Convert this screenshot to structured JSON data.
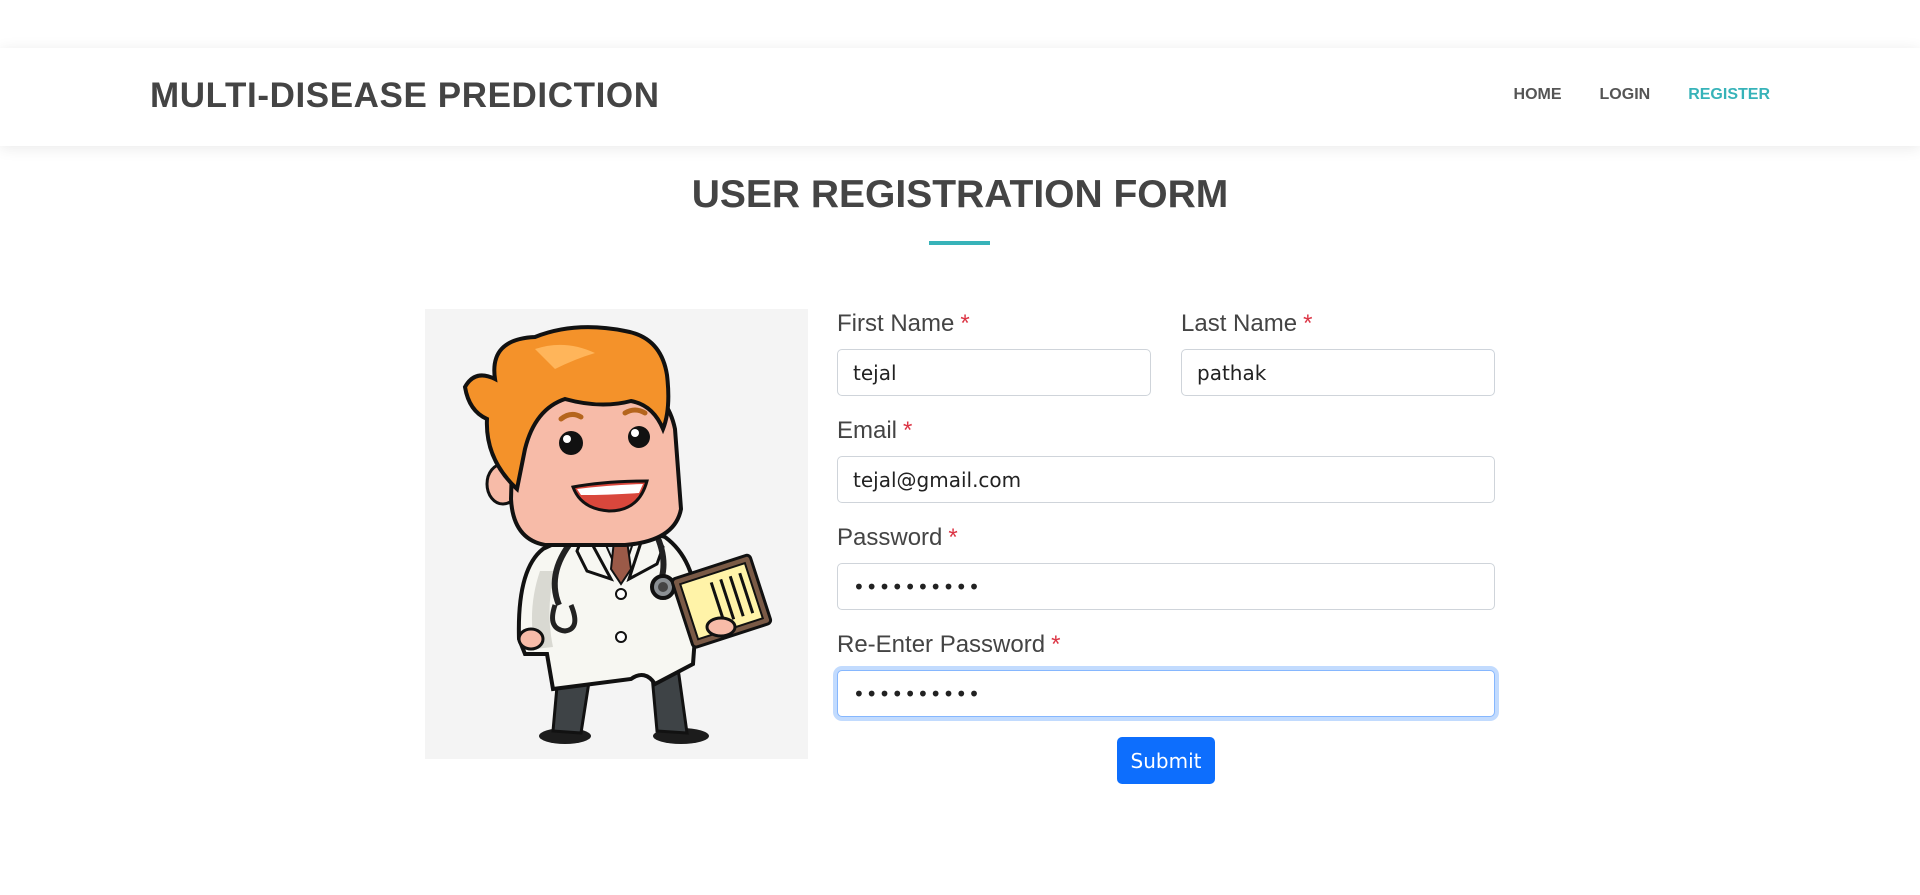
{
  "header": {
    "brand": "MULTI-DISEASE PREDICTION",
    "nav": [
      {
        "label": "HOME"
      },
      {
        "label": "LOGIN"
      },
      {
        "label": "REGISTER"
      }
    ],
    "active_nav": "REGISTER"
  },
  "page": {
    "title": "USER REGISTRATION FORM"
  },
  "form": {
    "first_name": {
      "label": "First Name",
      "required_mark": "*",
      "value": "tejal"
    },
    "last_name": {
      "label": "Last Name",
      "required_mark": "*",
      "value": "pathak"
    },
    "email": {
      "label": "Email",
      "required_mark": "*",
      "value": "tejal@gmail.com"
    },
    "password": {
      "label": "Password",
      "required_mark": "*",
      "value": "••••••••••"
    },
    "re_password": {
      "label": "Re-Enter Password",
      "required_mark": "*",
      "value": "••••••••••"
    },
    "submit_label": "Submit"
  },
  "illustration": {
    "icon": "doctor-cartoon-illustration"
  },
  "colors": {
    "accent": "#37b3b9",
    "primary_button": "#0d6efd",
    "required": "#dc3545",
    "text": "#444444"
  }
}
